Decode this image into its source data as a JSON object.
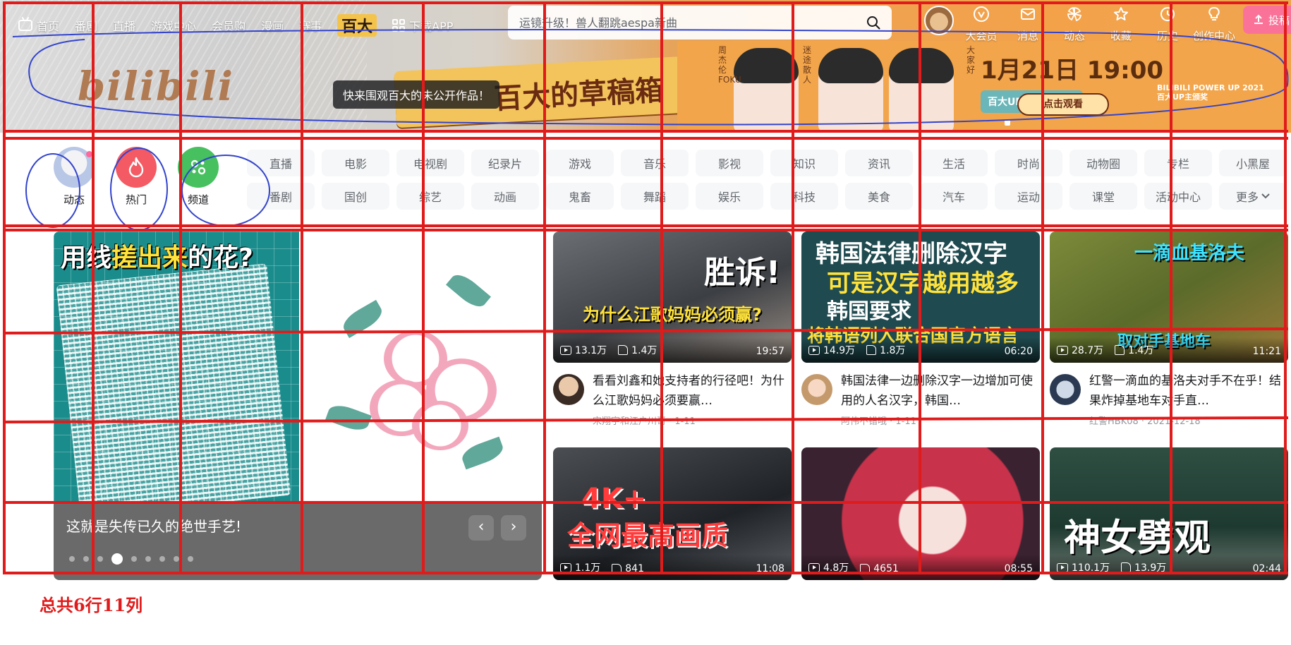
{
  "nav": {
    "left": [
      {
        "label": "首页",
        "icon": "tv-icon"
      },
      {
        "label": "番剧"
      },
      {
        "label": "直播"
      },
      {
        "label": "游戏中心"
      },
      {
        "label": "会员购"
      },
      {
        "label": "漫画"
      },
      {
        "label": "赛事"
      },
      {
        "label": "百大"
      },
      {
        "label": "下载APP",
        "icon": "grid-icon"
      }
    ],
    "search_placeholder": "运镜升级！兽人翻跳aespa新曲",
    "right": [
      {
        "label": "大会员",
        "icon": "vip-icon"
      },
      {
        "label": "消息",
        "icon": "message-icon"
      },
      {
        "label": "动态",
        "icon": "dynamic-icon"
      },
      {
        "label": "收藏",
        "icon": "star-icon"
      },
      {
        "label": "历史",
        "icon": "clock-icon"
      },
      {
        "label": "创作中心",
        "icon": "bulb-icon"
      }
    ],
    "upload_label": "投稿"
  },
  "banner": {
    "logo": "bilibili",
    "poster_title": "百大的草稿箱",
    "tooltip": "快来围观百大的未公开作品！",
    "date": "1月21日 19:00",
    "live_badge": "百大UP主 直播颁奖",
    "watch_button": "点击观看",
    "caption_1": "周杰伦FOKU",
    "caption_2": "迷途散人",
    "caption_3": "大家好",
    "powerup": "BILIBILI POWER UP 2021",
    "powerup_sub": "百大UP主颁奖"
  },
  "quick": [
    {
      "label": "动态",
      "icon": "avatar-icon"
    },
    {
      "label": "热门",
      "icon": "fire-icon"
    },
    {
      "label": "频道",
      "icon": "channel-icon"
    }
  ],
  "channels_row1": [
    "直播",
    "电影",
    "电视剧",
    "纪录片",
    "游戏",
    "音乐",
    "影视",
    "知识",
    "资讯",
    "生活",
    "时尚",
    "动物圈",
    "专栏",
    "小黑屋"
  ],
  "channels_row2": [
    "番剧",
    "国创",
    "综艺",
    "动画",
    "鬼畜",
    "舞蹈",
    "娱乐",
    "科技",
    "美食",
    "汽车",
    "运动",
    "课堂",
    "活动中心",
    "更多"
  ],
  "carousel": {
    "headline_a": "用线",
    "headline_b": "搓出来",
    "headline_c": "的花?",
    "caption": "这就是失传已久的绝世手艺!",
    "dots_total": 9,
    "active_dot": 3
  },
  "videos": [
    {
      "plays": "13.1万",
      "likes": "1.4万",
      "duration": "19:57",
      "title": "看看刘鑫和她支持者的行径吧！为什么江歌妈妈必须要赢…",
      "owner": "宋翔宇和江户川哥 · 1-11",
      "thumb_big": "胜诉!",
      "thumb_sub": "为什么江歌妈妈必须赢?"
    },
    {
      "plays": "14.9万",
      "likes": "1.8万",
      "duration": "06:20",
      "title": "韩国法律一边删除汉字一边增加可使用的人名汉字，韩国…",
      "owner": "阿伟不错哦 · 1-11",
      "thumb_big": "韩国法律删除汉字",
      "thumb_sub": "可是汉字越用越多",
      "thumb_sub2": "韩国要求",
      "thumb_sub3": "将韩语列入联合国官方语言"
    },
    {
      "plays": "28.7万",
      "likes": "1.4万",
      "duration": "11:21",
      "title": "红警一滴血的基洛夫对手不在乎！结果炸掉基地车对手直…",
      "owner": "红警HBK08 · 2021-12-18",
      "thumb_big": "一滴血基洛夫",
      "thumb_sub": "取对手基地车"
    },
    {
      "plays": "1.1万",
      "likes": "841",
      "duration": "11:08",
      "title": "",
      "owner": "",
      "thumb_big": "4K+",
      "thumb_sub": "全网最高画质"
    },
    {
      "plays": "4.8万",
      "likes": "4651",
      "duration": "08:55",
      "title": "",
      "owner": "",
      "thumb_big": "",
      "thumb_sub": ""
    },
    {
      "plays": "110.1万",
      "likes": "13.9万",
      "duration": "02:44",
      "title": "",
      "owner": "",
      "thumb_big": "神女劈观",
      "thumb_sub": ""
    }
  ],
  "annotation": {
    "caption": "总共6行11列",
    "rows": 6,
    "cols": 11,
    "line_color": "#e01b1b",
    "circle_color": "#3344cc"
  },
  "colors": {
    "accent_pink": "#fb7299",
    "hot_red": "#f35a63",
    "channel_green": "#47c05f",
    "banner_orange": "#f2a54a"
  }
}
